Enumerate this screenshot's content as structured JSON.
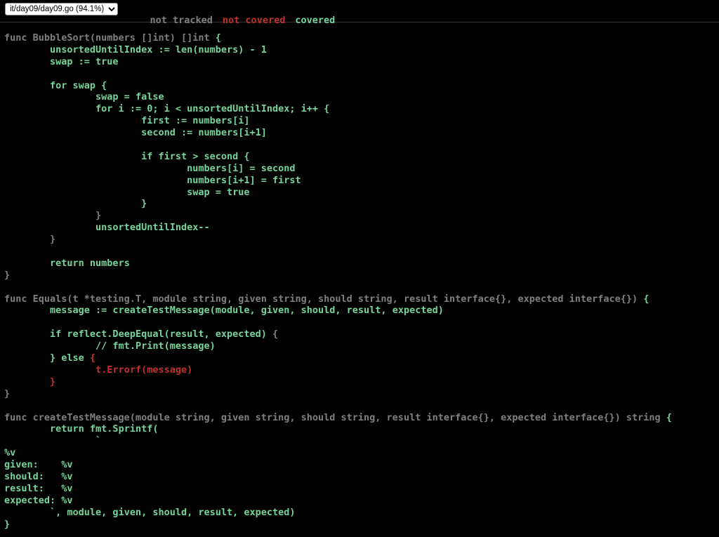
{
  "file_selector": {
    "selected": "it/day09/day09.go (94.1%)",
    "options": [
      "it/day09/day09.go (94.1%)"
    ]
  },
  "legend": {
    "not_tracked": "not tracked",
    "not_covered": "not covered",
    "covered": "covered"
  },
  "colors": {
    "not_tracked": "#808080",
    "not_covered": "#c0312b",
    "covered": "#76d59a",
    "background": "#000000"
  },
  "code_lines": [
    [
      {
        "t": "func BubbleSort(numbers []int) []int ",
        "c": "c0"
      },
      {
        "t": "{",
        "c": "c2"
      }
    ],
    [
      {
        "t": "\tunsortedUntilIndex := len(numbers) - 1",
        "c": "c2"
      }
    ],
    [
      {
        "t": "\tswap := true",
        "c": "c2"
      }
    ],
    [],
    [
      {
        "t": "\tfor swap {",
        "c": "c2"
      }
    ],
    [
      {
        "t": "\t\tswap = false",
        "c": "c2"
      }
    ],
    [
      {
        "t": "\t\tfor i := 0; i < unsortedUntilIndex; i++ {",
        "c": "c2"
      }
    ],
    [
      {
        "t": "\t\t\tfirst := numbers[i]",
        "c": "c2"
      }
    ],
    [
      {
        "t": "\t\t\tsecond := numbers[i+1]",
        "c": "c2"
      }
    ],
    [],
    [
      {
        "t": "\t\t\tif first > second {",
        "c": "c2"
      }
    ],
    [
      {
        "t": "\t\t\t\tnumbers[i] = second",
        "c": "c2"
      }
    ],
    [
      {
        "t": "\t\t\t\tnumbers[i+1] = first",
        "c": "c2"
      }
    ],
    [
      {
        "t": "\t\t\t\tswap = true",
        "c": "c2"
      }
    ],
    [
      {
        "t": "\t\t\t}",
        "c": "c2"
      }
    ],
    [
      {
        "t": "\t\t}",
        "c": "c0"
      }
    ],
    [
      {
        "t": "\t\tunsortedUntilIndex--",
        "c": "c2"
      }
    ],
    [
      {
        "t": "\t}",
        "c": "c0"
      }
    ],
    [],
    [
      {
        "t": "\treturn numbers",
        "c": "c2"
      }
    ],
    [
      {
        "t": "}",
        "c": "c0"
      }
    ],
    [],
    [
      {
        "t": "func Equals(t *testing.T, module string, given string, should string, result interface{}, expected interface{}) ",
        "c": "c0"
      },
      {
        "t": "{",
        "c": "c2"
      }
    ],
    [
      {
        "t": "\tmessage := createTestMessage(module, given, should, result, expected)",
        "c": "c2"
      }
    ],
    [],
    [
      {
        "t": "\tif reflect.DeepEqual(result, expected) ",
        "c": "c2"
      },
      {
        "t": "{",
        "c": "c0"
      }
    ],
    [
      {
        "t": "\t\t// fmt.Print(message)",
        "c": "c2"
      }
    ],
    [
      {
        "t": "\t} else ",
        "c": "c2"
      },
      {
        "t": "{",
        "c": "c1"
      }
    ],
    [
      {
        "t": "\t\tt.Errorf(message)",
        "c": "c1"
      }
    ],
    [
      {
        "t": "\t}",
        "c": "c1"
      }
    ],
    [
      {
        "t": "}",
        "c": "c0"
      }
    ],
    [],
    [
      {
        "t": "func createTestMessage(module string, given string, should string, result interface{}, expected interface{}) string ",
        "c": "c0"
      },
      {
        "t": "{",
        "c": "c2"
      }
    ],
    [
      {
        "t": "\treturn fmt.Sprintf(",
        "c": "c2"
      }
    ],
    [
      {
        "t": "\t\t`",
        "c": "c2"
      }
    ],
    [
      {
        "t": "%v",
        "c": "c2"
      }
    ],
    [
      {
        "t": "given:    %v",
        "c": "c2"
      }
    ],
    [
      {
        "t": "should:   %v",
        "c": "c2"
      }
    ],
    [
      {
        "t": "result:   %v",
        "c": "c2"
      }
    ],
    [
      {
        "t": "expected: %v",
        "c": "c2"
      }
    ],
    [
      {
        "t": "\t`, module, given, should, result, expected)",
        "c": "c2"
      }
    ],
    [
      {
        "t": "}",
        "c": "c2"
      }
    ]
  ]
}
